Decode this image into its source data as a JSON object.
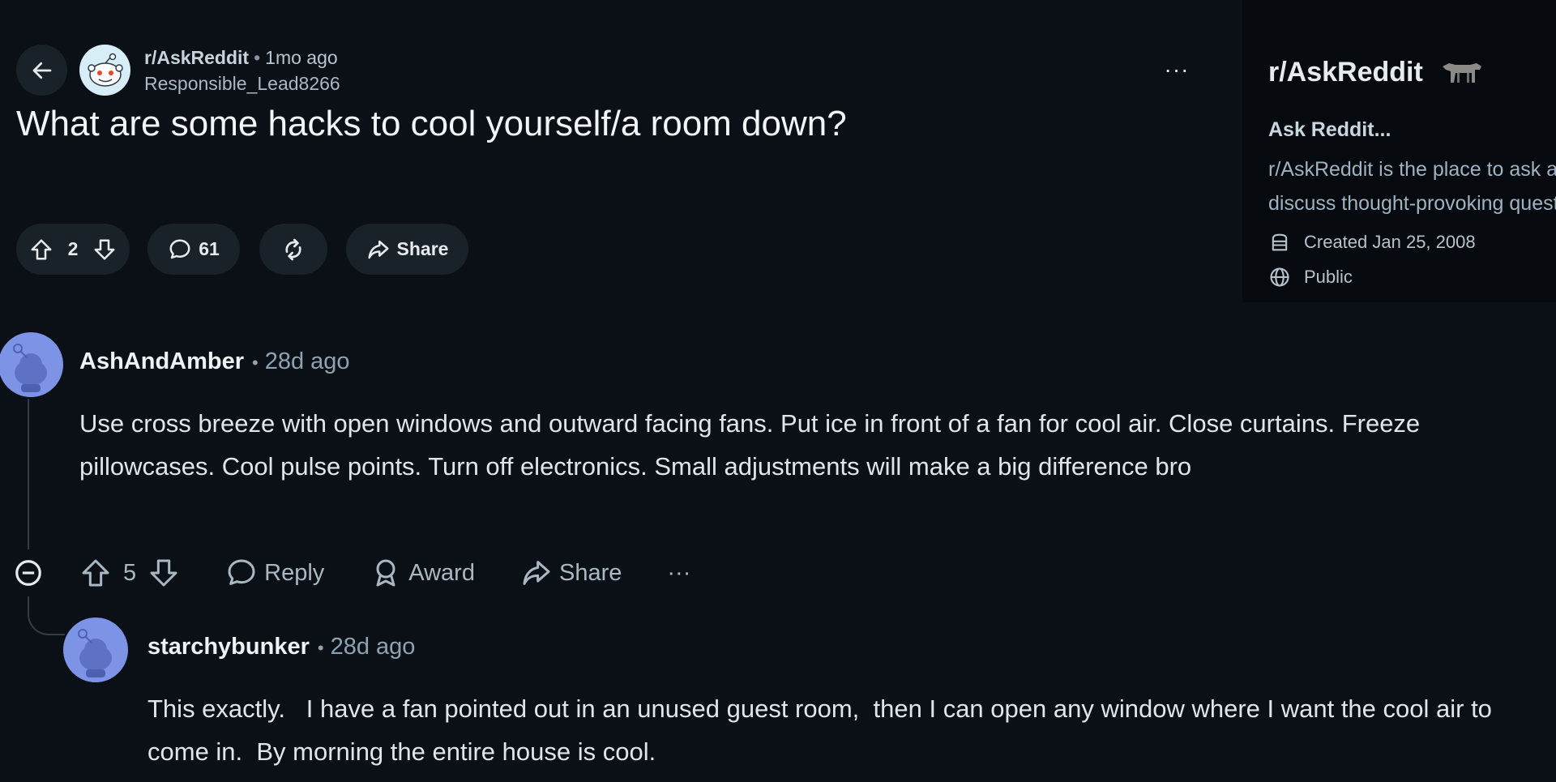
{
  "post": {
    "subreddit": "r/AskReddit",
    "separator": "•",
    "time": "1mo ago",
    "author": "Responsible_Lead8266",
    "overflow": "···",
    "title": "What are some hacks to cool yourself/a room down?",
    "votes": "2",
    "comments": "61",
    "share_label": "Share"
  },
  "sidebar": {
    "title": "r/AskReddit",
    "name": "Ask Reddit...",
    "description": "r/AskReddit is the place to ask and discuss thought-provoking questions.",
    "created": "Created Jan 25, 2008",
    "visibility": "Public"
  },
  "comments": [
    {
      "author": "AshAndAmber",
      "separator": "•",
      "time": "28d ago",
      "body": "Use cross breeze with open windows and outward facing fans. Put ice in front of a fan for cool air. Close curtains. Freeze pillowcases. Cool pulse points. Turn off electronics. Small adjustments will make a big difference bro",
      "votes": "5",
      "reply_label": "Reply",
      "award_label": "Award",
      "share_label": "Share",
      "overflow": "···"
    },
    {
      "author": "starchybunker",
      "separator": "•",
      "time": "28d ago",
      "body": "This exactly.   I have a fan pointed out in an unused guest room,  then I can open any window where I want the cool air to come in.  By morning the entire house is cool."
    }
  ],
  "colors": {
    "background": "#0b1016",
    "pill": "#1a2229",
    "sidebar": "#060a0e",
    "snoo_avatar": "#7d94e6",
    "link": "#9fb2c1"
  },
  "icons": [
    "back-arrow-icon",
    "snoo-avatar-icon",
    "upvote-icon",
    "downvote-icon",
    "comment-icon",
    "crosspost-icon",
    "share-icon",
    "calendar-icon",
    "globe-icon",
    "collapse-icon",
    "award-icon"
  ]
}
